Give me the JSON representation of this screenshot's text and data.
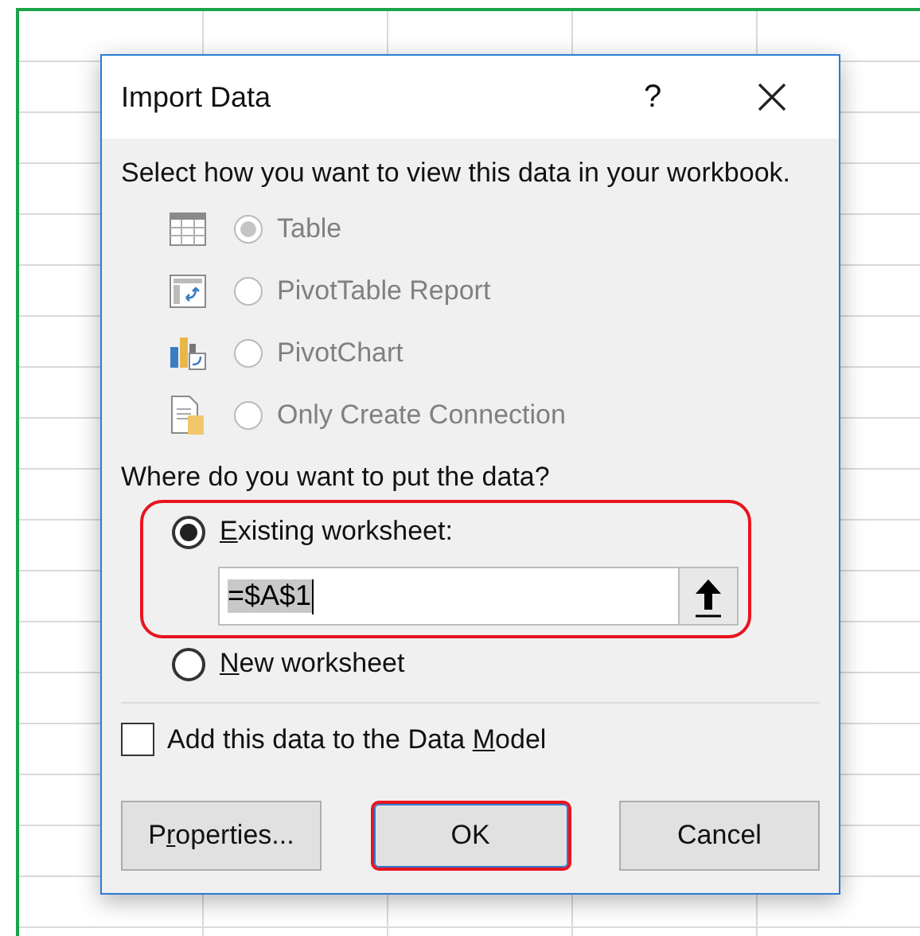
{
  "window": {
    "title": "Import Data",
    "help": "?"
  },
  "view_prompt": "Select how you want to view this data in your workbook.",
  "view_options": [
    {
      "kind": "table",
      "label": "Table",
      "selected": true,
      "disabled": true
    },
    {
      "kind": "pivottable",
      "label": "PivotTable Report",
      "selected": false,
      "disabled": true
    },
    {
      "kind": "pivotchart",
      "label": "PivotChart",
      "selected": false,
      "disabled": true
    },
    {
      "kind": "connection",
      "label": "Only Create Connection",
      "selected": false,
      "disabled": true
    }
  ],
  "location_prompt": "Where do you want to put the data?",
  "location_options": [
    {
      "label": [
        {
          "text": "E",
          "underlined": true
        },
        {
          "text": "xisting worksheet:",
          "underlined": false
        }
      ],
      "selected": true,
      "highlighted": true,
      "field": {
        "value": "=$A$1"
      }
    },
    {
      "label": [
        {
          "text": "N",
          "underlined": true
        },
        {
          "text": "ew worksheet",
          "underlined": false
        }
      ],
      "selected": false,
      "highlighted": false
    }
  ],
  "data_model": {
    "label": [
      {
        "text": "Add this data to the Data ",
        "underlined": false
      },
      {
        "text": "M",
        "underlined": true
      },
      {
        "text": "odel",
        "underlined": false
      }
    ],
    "checked": false
  },
  "buttons": [
    {
      "label": [
        {
          "text": "P",
          "underlined": false
        },
        {
          "text": "r",
          "underlined": true
        },
        {
          "text": "operties...",
          "underlined": false
        }
      ],
      "highlighted": false
    },
    {
      "label": [
        {
          "text": "OK",
          "underlined": false
        }
      ],
      "highlighted": true
    },
    {
      "label": [
        {
          "text": "Cancel",
          "underlined": false
        }
      ],
      "highlighted": false
    }
  ]
}
